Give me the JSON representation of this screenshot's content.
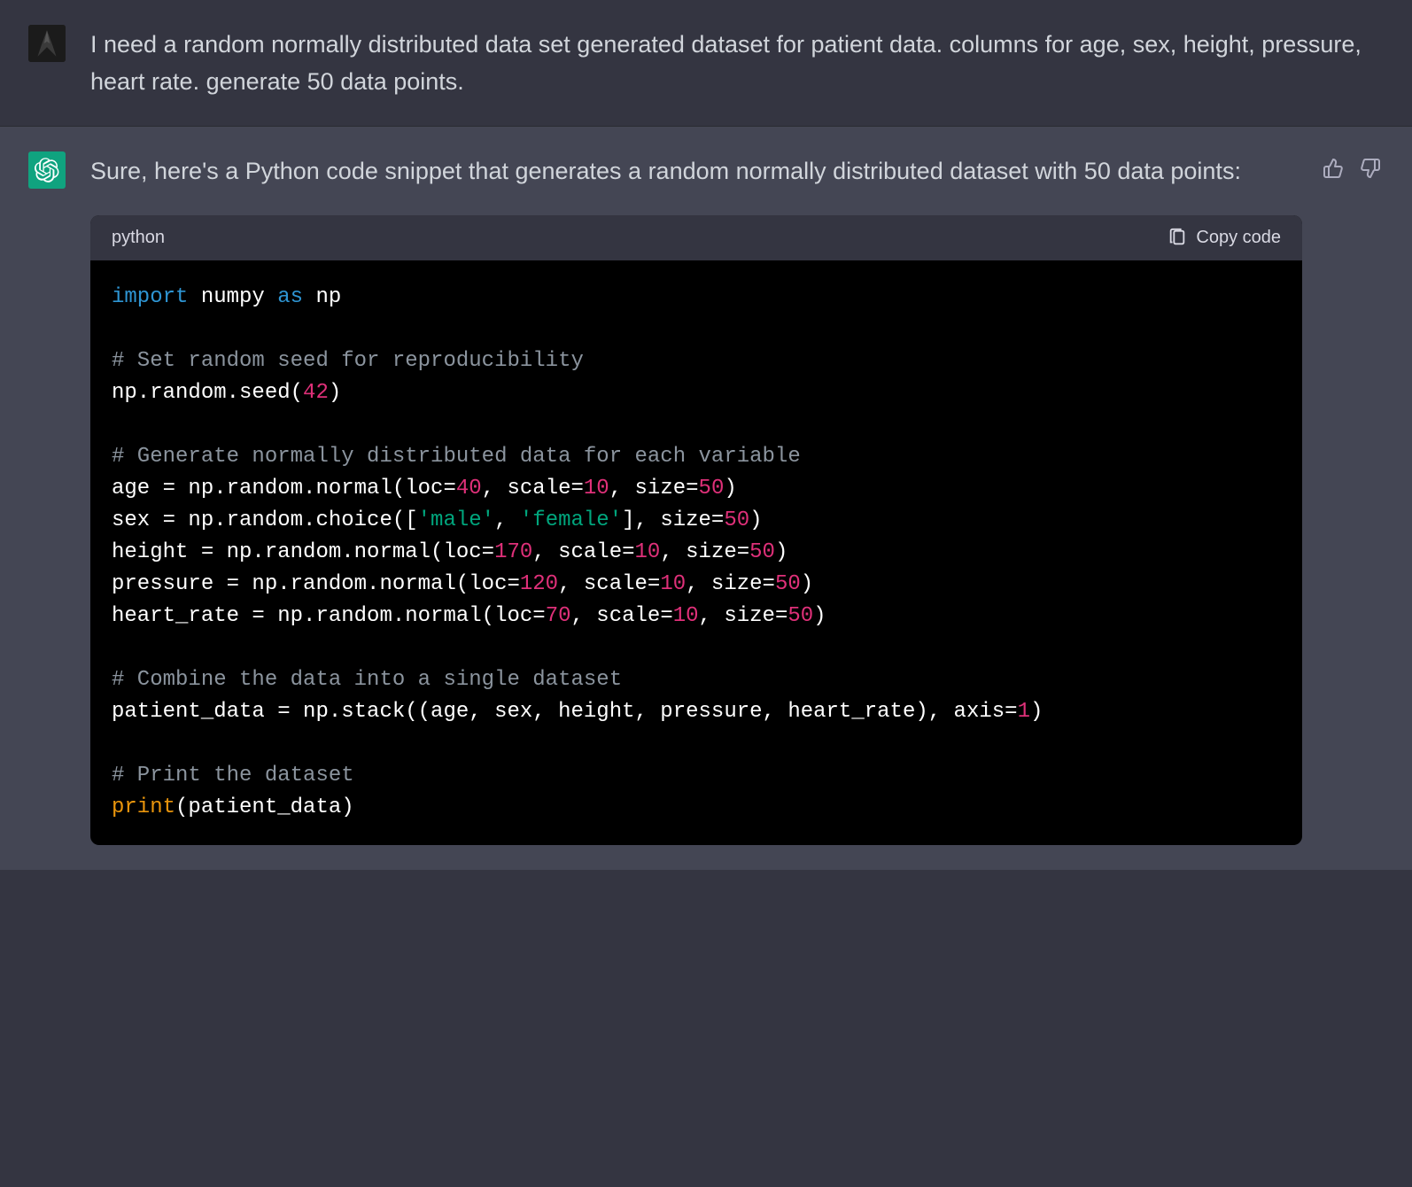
{
  "user": {
    "text": "I need a random normally distributed data set generated dataset for patient data. columns for age, sex, height, pressure, heart rate. generate 50 data points."
  },
  "assistant": {
    "intro_text": "Sure, here's a Python code snippet that generates a random normally distributed dataset with 50 data points:",
    "code_language": "python",
    "copy_label": "Copy code",
    "code": {
      "l1_import": "import",
      "l1_numpy": " numpy ",
      "l1_as": "as",
      "l1_np": " np",
      "l3_comment": "# Set random seed for reproducibility",
      "l4_a": "np.random.seed(",
      "l4_num": "42",
      "l4_b": ")",
      "l6_comment": "# Generate normally distributed data for each variable",
      "l7_a": "age = np.random.normal(loc=",
      "l7_n1": "40",
      "l7_b": ", scale=",
      "l7_n2": "10",
      "l7_c": ", size=",
      "l7_n3": "50",
      "l7_d": ")",
      "l8_a": "sex = np.random.choice([",
      "l8_s1": "'male'",
      "l8_b": ", ",
      "l8_s2": "'female'",
      "l8_c": "], size=",
      "l8_n1": "50",
      "l8_d": ")",
      "l9_a": "height = np.random.normal(loc=",
      "l9_n1": "170",
      "l9_b": ", scale=",
      "l9_n2": "10",
      "l9_c": ", size=",
      "l9_n3": "50",
      "l9_d": ")",
      "l10_a": "pressure = np.random.normal(loc=",
      "l10_n1": "120",
      "l10_b": ", scale=",
      "l10_n2": "10",
      "l10_c": ", size=",
      "l10_n3": "50",
      "l10_d": ")",
      "l11_a": "heart_rate = np.random.normal(loc=",
      "l11_n1": "70",
      "l11_b": ", scale=",
      "l11_n2": "10",
      "l11_c": ", size=",
      "l11_n3": "50",
      "l11_d": ")",
      "l13_comment": "# Combine the data into a single dataset",
      "l14_a": "patient_data = np.stack((age, sex, height, pressure, heart_rate), axis=",
      "l14_n1": "1",
      "l14_b": ")",
      "l16_comment": "# Print the dataset",
      "l17_fn": "print",
      "l17_a": "(patient_data)"
    }
  }
}
